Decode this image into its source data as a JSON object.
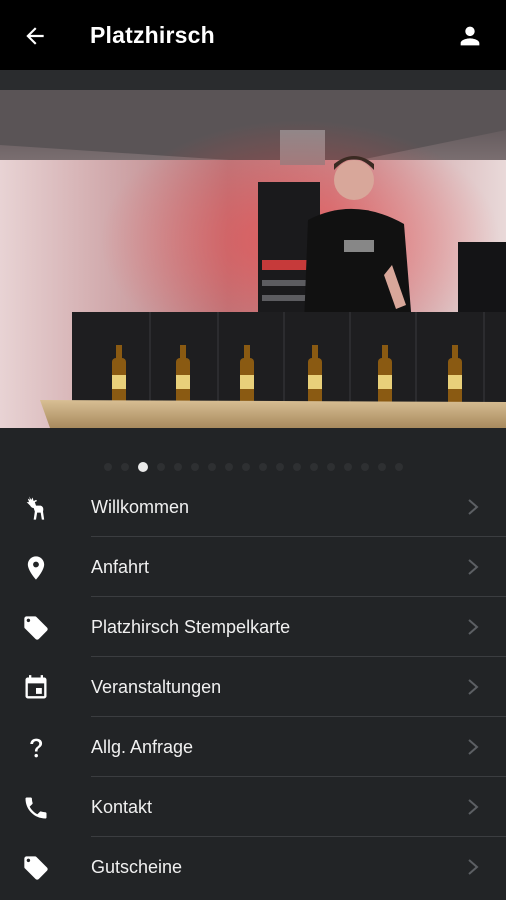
{
  "appbar": {
    "title": "Platzhirsch",
    "back_icon": "arrow-left-icon",
    "profile_icon": "person-icon"
  },
  "hero": {
    "image": "dj-at-bar-photo",
    "page_count": 18,
    "active_page": 3
  },
  "menu": {
    "items": [
      {
        "label": "Willkommen",
        "icon": "deer-icon"
      },
      {
        "label": "Anfahrt",
        "icon": "location-pin-icon"
      },
      {
        "label": "Platzhirsch Stempelkarte",
        "icon": "tag-icon"
      },
      {
        "label": "Veranstaltungen",
        "icon": "calendar-icon"
      },
      {
        "label": "Allg. Anfrage",
        "icon": "question-icon"
      },
      {
        "label": "Kontakt",
        "icon": "phone-icon"
      },
      {
        "label": "Gutscheine",
        "icon": "tag-icon"
      }
    ]
  },
  "colors": {
    "appbar": "#000000",
    "background": "#222426",
    "separator": "#3b3d40",
    "chevron": "#5c5f63"
  }
}
